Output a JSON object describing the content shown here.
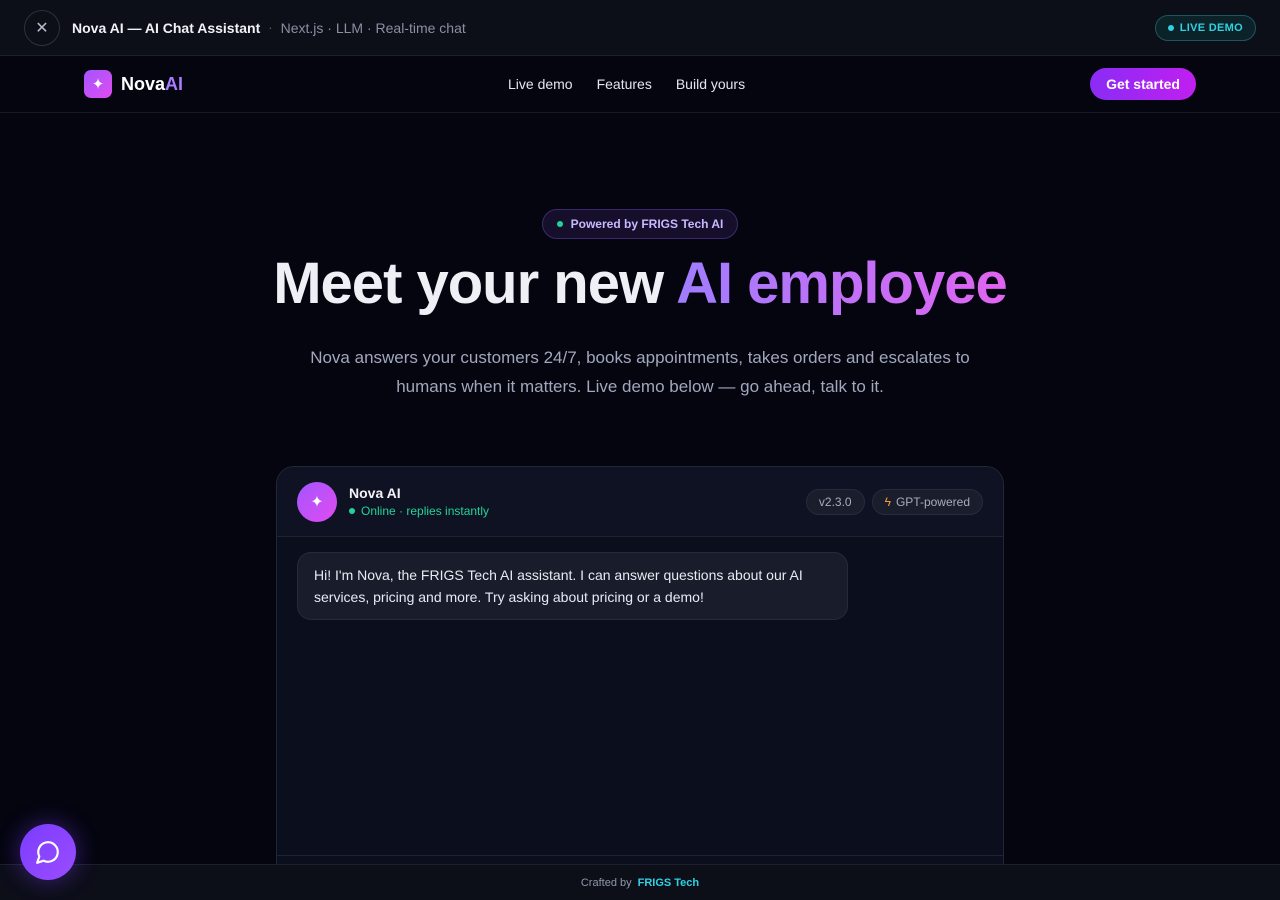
{
  "demo_bar": {
    "close_icon": "close-icon",
    "title": "Nova AI — AI Chat Assistant",
    "separator": "·",
    "tech": "Next.js · LLM · Real-time chat",
    "badge": "LIVE DEMO"
  },
  "nav": {
    "logo_icon": "sparkle-icon",
    "logo_text": "Nova",
    "logo_accent": "AI",
    "links": [
      "Live demo",
      "Features",
      "Build yours"
    ],
    "cta": "Get started"
  },
  "hero": {
    "pill": "Powered by FRIGS Tech AI",
    "title_plain": "Meet your new ",
    "title_accent": "AI employee",
    "subtitle": "Nova answers your customers 24/7, books appointments, takes orders and escalates to humans when it matters. Live demo below — go ahead, talk to it."
  },
  "chat": {
    "avatar_icon": "sparkle-icon",
    "name": "Nova AI",
    "status": "Online · replies instantly",
    "version": "v2.3.0",
    "model_tag": "GPT-powered",
    "model_icon": "bolt-icon",
    "messages": [
      {
        "from": "assistant",
        "text": "Hi! I'm Nova, the FRIGS Tech AI assistant. I can answer questions about our AI services, pricing and more. Try asking about pricing or a demo!"
      }
    ]
  },
  "fab_icon": "chat-bubble-icon",
  "footer": {
    "prefix": "Crafted by",
    "brand": "FRIGS Tech"
  },
  "colors": {
    "background": "#04050f",
    "accent_purple": "#8a2cf5",
    "accent_pink": "#e04cf0",
    "online_green": "#22d39a",
    "live_cyan": "#2fd1e3"
  }
}
